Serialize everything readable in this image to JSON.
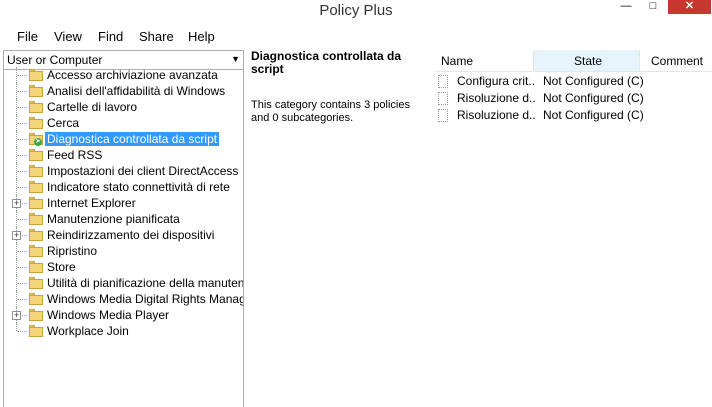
{
  "window": {
    "title": "Policy Plus",
    "min_glyph": "—",
    "max_glyph": "□",
    "close_glyph": "✕"
  },
  "menu": [
    "File",
    "View",
    "Find",
    "Share",
    "Help"
  ],
  "scope": {
    "selected": "User or Computer"
  },
  "tree": [
    {
      "label": "Accesso archiviazione avanzata",
      "expandable": false,
      "selected": false
    },
    {
      "label": "Analisi dell'affidabilità di Windows",
      "expandable": false,
      "selected": false
    },
    {
      "label": "Cartelle di lavoro",
      "expandable": false,
      "selected": false
    },
    {
      "label": "Cerca",
      "expandable": false,
      "selected": false
    },
    {
      "label": "Diagnostica controllata da script",
      "expandable": false,
      "selected": true
    },
    {
      "label": "Feed RSS",
      "expandable": false,
      "selected": false
    },
    {
      "label": "Impostazioni dei client DirectAccess",
      "expandable": false,
      "selected": false
    },
    {
      "label": "Indicatore stato connettività di rete",
      "expandable": false,
      "selected": false
    },
    {
      "label": "Internet Explorer",
      "expandable": true,
      "selected": false
    },
    {
      "label": "Manutenzione pianificata",
      "expandable": false,
      "selected": false
    },
    {
      "label": "Reindirizzamento dei dispositivi",
      "expandable": true,
      "selected": false
    },
    {
      "label": "Ripristino",
      "expandable": false,
      "selected": false
    },
    {
      "label": "Store",
      "expandable": false,
      "selected": false
    },
    {
      "label": "Utilità di pianificazione della manutenzione",
      "expandable": false,
      "selected": false
    },
    {
      "label": "Windows Media Digital Rights Manageme",
      "expandable": false,
      "selected": false
    },
    {
      "label": "Windows Media Player",
      "expandable": true,
      "selected": false
    },
    {
      "label": "Workplace Join",
      "expandable": false,
      "selected": false
    }
  ],
  "detail": {
    "title": "Diagnostica controllata da script",
    "description": "This category contains 3 policies and 0 subcategories."
  },
  "policies": {
    "columns": {
      "name": "Name",
      "state": "State",
      "comment": "Comment"
    },
    "rows": [
      {
        "name": "Configura crit...",
        "state": "Not Configured (C)"
      },
      {
        "name": "Risoluzione d...",
        "state": "Not Configured (C)"
      },
      {
        "name": "Risoluzione d...",
        "state": "Not Configured (C)"
      }
    ]
  }
}
